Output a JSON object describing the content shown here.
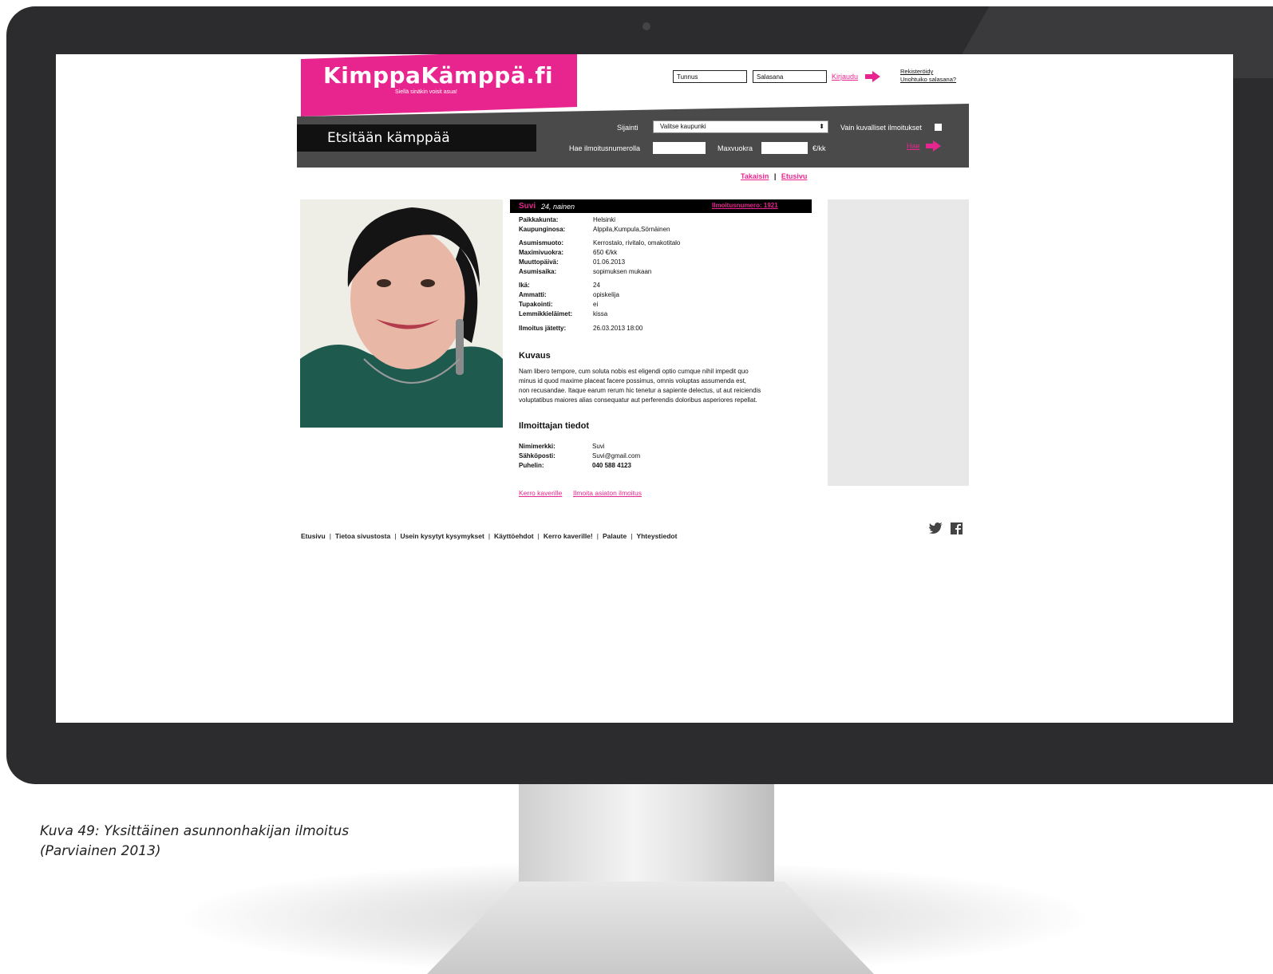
{
  "caption": {
    "line1": "Kuva 49: Yksittäinen asunnonhakijan ilmoitus",
    "line2": "(Parviainen 2013)"
  },
  "site": {
    "logo": "KimppaKämppä.fi",
    "tagline": "Siellä sinäkin voisit asua!",
    "login": {
      "username_placeholder": "Tunnus",
      "password_placeholder": "Salasana",
      "login_label": "Kirjaudu",
      "register_label": "Rekisteröidy",
      "forgot_label": "Unohtuiko salasana?"
    }
  },
  "search": {
    "title": "Etsitään kämppää",
    "location_label": "Sijainti",
    "location_value": "Valitse kaupunki",
    "only_images_label": "Vain kuvalliset ilmoitukset",
    "search_by_number_label": "Hae ilmoitusnumerolla",
    "max_rent_label": "Maxvuokra",
    "rent_unit": "€/kk",
    "search_button": "Hae"
  },
  "breadcrumb": {
    "back": "Takaisin",
    "sep": "|",
    "home": "Etusivu"
  },
  "listing": {
    "name": "Suvi",
    "age_gender": "24, nainen",
    "number_label": "Ilmoitusnumero: 1921",
    "details": [
      {
        "key": "Paikkakunta:",
        "value": "Helsinki"
      },
      {
        "key": "Kaupunginosa:",
        "value": "Alppila,Kumpula,Sörnäinen"
      },
      {
        "key": "Asumismuoto:",
        "value": "Kerrostalo, rivitalo, omakotitalo"
      },
      {
        "key": "Maximivuokra:",
        "value": "650 €/kk"
      },
      {
        "key": "Muuttopäivä:",
        "value": "01.06.2013"
      },
      {
        "key": "Asumisaika:",
        "value": "sopimuksen mukaan"
      },
      {
        "key": "Ikä:",
        "value": "24"
      },
      {
        "key": "Ammatti:",
        "value": "opiskelija"
      },
      {
        "key": "Tupakointi:",
        "value": "ei"
      },
      {
        "key": "Lemmikkieläimet:",
        "value": "kissa"
      },
      {
        "key": "Ilmoitus jätetty:",
        "value": "26.03.2013 18:00"
      }
    ],
    "description_title": "Kuvaus",
    "description_lines": [
      "Nam libero tempore, cum soluta nobis est eligendi optio cumque nihil impedit quo",
      "minus id quod maxime placeat facere possimus, omnis voluptas assumenda est,",
      "non recusandae. Itaque earum rerum hic tenetur a sapiente delectus, ut aut reiciendis",
      "voluptatibus maiores alias consequatur aut perferendis doloribus asperiores repellat."
    ],
    "poster_title": "Ilmoittajan tiedot",
    "poster": [
      {
        "key": "Nimimerkki:",
        "value": "Suvi"
      },
      {
        "key": "Sähköposti:",
        "value": "Suvi@gmail.com"
      },
      {
        "key": "Puhelin:",
        "value": "040 588 4123"
      }
    ],
    "share_link": "Kerro kaverille",
    "report_link": "Ilmoita asiaton ilmoitus"
  },
  "footer": {
    "links": [
      "Etusivu",
      "Tietoa sivustosta",
      "Usein kysytyt kysymykset",
      "Käyttöehdot",
      "Kerro kaverille!",
      "Palaute",
      "Yhteystiedot"
    ],
    "separator": "|"
  },
  "colors": {
    "brand_pink": "#e8258e",
    "bar_gray": "#4a4a4a",
    "bezel": "#2c2c2e"
  },
  "icons": [
    "twitter-icon",
    "facebook-icon",
    "arrow-right-icon",
    "select-caret-icon"
  ]
}
